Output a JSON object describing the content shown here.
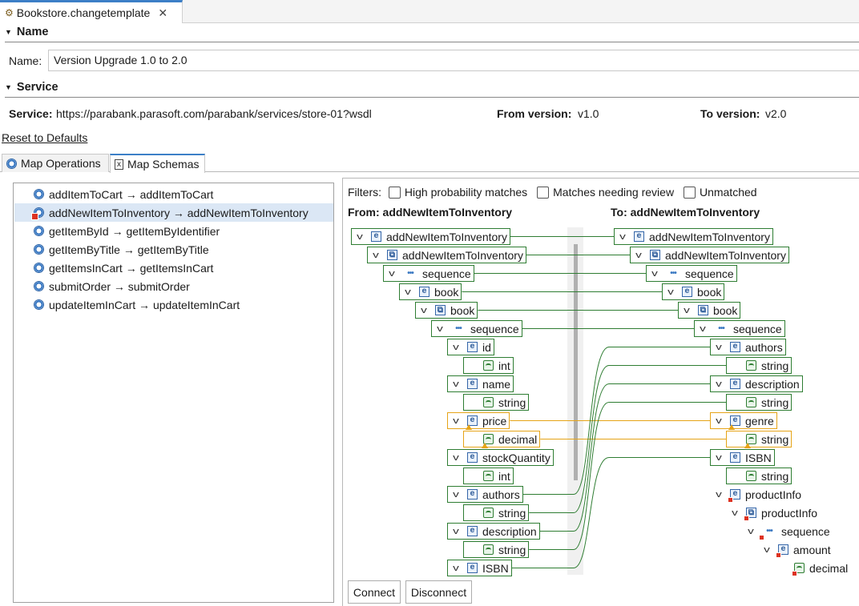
{
  "editor_tab": {
    "title": "Bookstore.changetemplate",
    "close": "✕"
  },
  "name_section": {
    "header": "Name",
    "label": "Name:",
    "value": "Version Upgrade 1.0 to 2.0"
  },
  "service_section": {
    "header": "Service",
    "service_label": "Service:",
    "service_value": "https://parabank.parasoft.com/parabank/services/store-01?wsdl",
    "from_label": "From version:",
    "from_value": "v1.0",
    "to_label": "To version:",
    "to_value": "v2.0"
  },
  "reset_link": "Reset to Defaults",
  "map_tabs": [
    {
      "label": "Map Operations"
    },
    {
      "label": "Map Schemas"
    }
  ],
  "operations": [
    {
      "label": "addItemToCart → addItemToCart"
    },
    {
      "label": "addNewItemToInventory → addNewItemToInventory"
    },
    {
      "label": "getItemById → getItemByIdentifier"
    },
    {
      "label": "getItemByTitle → getItemByTitle"
    },
    {
      "label": "getItemsInCart → getItemsInCart"
    },
    {
      "label": "submitOrder → submitOrder"
    },
    {
      "label": "updateItemInCart → updateItemInCart"
    }
  ],
  "filters": {
    "label": "Filters:",
    "high": "High probability matches",
    "review": "Matches needing review",
    "unmatched": "Unmatched"
  },
  "from_title": "From: addNewItemToInventory",
  "to_title": "To: addNewItemToInventory",
  "from_tree": [
    {
      "label": "addNewItemToInventory",
      "icon": "element"
    },
    {
      "label": "addNewItemToInventory",
      "icon": "complex-type"
    },
    {
      "label": "sequence",
      "icon": "sequence"
    },
    {
      "label": "book",
      "icon": "element"
    },
    {
      "label": "book",
      "icon": "complex-type"
    },
    {
      "label": "sequence",
      "icon": "sequence"
    },
    {
      "label": "id",
      "icon": "element"
    },
    {
      "label": "int",
      "icon": "simple-type"
    },
    {
      "label": "name",
      "icon": "element"
    },
    {
      "label": "string",
      "icon": "simple-type"
    },
    {
      "label": "price",
      "icon": "element",
      "status": "warning"
    },
    {
      "label": "decimal",
      "icon": "simple-type",
      "status": "warning"
    },
    {
      "label": "stockQuantity",
      "icon": "element"
    },
    {
      "label": "int",
      "icon": "simple-type"
    },
    {
      "label": "authors",
      "icon": "element"
    },
    {
      "label": "string",
      "icon": "simple-type"
    },
    {
      "label": "description",
      "icon": "element"
    },
    {
      "label": "string",
      "icon": "simple-type"
    },
    {
      "label": "ISBN",
      "icon": "element"
    }
  ],
  "to_tree": [
    {
      "label": "addNewItemToInventory",
      "icon": "element"
    },
    {
      "label": "addNewItemToInventory",
      "icon": "complex-type"
    },
    {
      "label": "sequence",
      "icon": "sequence"
    },
    {
      "label": "book",
      "icon": "element"
    },
    {
      "label": "book",
      "icon": "complex-type"
    },
    {
      "label": "sequence",
      "icon": "sequence"
    },
    {
      "label": "authors",
      "icon": "element"
    },
    {
      "label": "string",
      "icon": "simple-type"
    },
    {
      "label": "description",
      "icon": "element"
    },
    {
      "label": "string",
      "icon": "simple-type"
    },
    {
      "label": "genre",
      "icon": "element",
      "status": "warning"
    },
    {
      "label": "string",
      "icon": "simple-type",
      "status": "warning"
    },
    {
      "label": "ISBN",
      "icon": "element"
    },
    {
      "label": "string",
      "icon": "simple-type"
    },
    {
      "label": "productInfo",
      "icon": "element",
      "status": "error"
    },
    {
      "label": "productInfo",
      "icon": "complex-type",
      "status": "error"
    },
    {
      "label": "sequence",
      "icon": "sequence",
      "status": "error"
    },
    {
      "label": "amount",
      "icon": "element",
      "status": "error"
    },
    {
      "label": "decimal",
      "icon": "simple-type",
      "status": "error"
    }
  ],
  "buttons": {
    "connect": "Connect",
    "disconnect": "Disconnect"
  },
  "colors": {
    "match_line": "#2e7d32",
    "review_line": "#e6a417",
    "accent": "#3c7fc7"
  }
}
